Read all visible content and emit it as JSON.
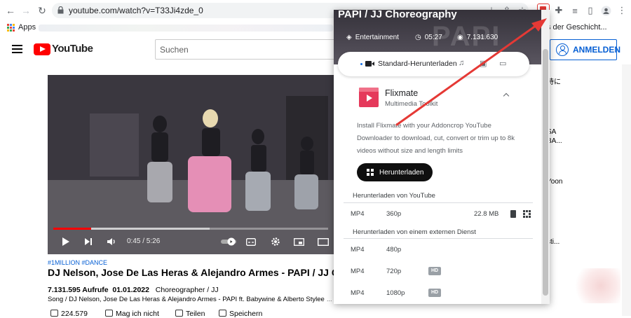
{
  "browser": {
    "url": "youtube.com/watch?v=T33Ji4zde_0",
    "bookmarks_apps": "Apps",
    "bookmark_right": "s der Geschicht..."
  },
  "youtube": {
    "logo_text": "YouTube",
    "search_placeholder": "Suchen",
    "signin_label": "ANMELDEN",
    "video": {
      "time": "0:45 / 5:26",
      "progress": 0.138,
      "buffered": 0.57,
      "tags": "#1MILLION #DANCE",
      "title": "DJ Nelson, Jose De Las Heras & Alejandro Armes - PAPI / JJ Choreography",
      "views": "7.131.595 Aufrufe",
      "date": "01.01.2022",
      "category": "Choreographer / JJ",
      "description": "Song / DJ Nelson, Jose De Las Heras & Alejandro Armes - PAPI ft. Babywine & Alberto Stylee",
      "more": "...",
      "likes": "224.579",
      "dislike": "Mag ich nicht",
      "share": "Teilen",
      "save": "Speichern"
    },
    "sidebar_fragments": [
      "時に",
      "SA",
      "BA...",
      "Yoon",
      "sti..."
    ]
  },
  "popup": {
    "hero_title": "PAPI / JJ Choreography",
    "hero_watermark": "PAPI",
    "category": "Entertainment",
    "duration": "05:27",
    "views": "7.131.630",
    "tab_active": "Standard-Herunterladen",
    "app_name": "Flixmate",
    "app_subtitle": "Multimedia Toolkit",
    "app_description": "Install Flixmate with your Addoncrop YouTube Downloader to download, cut, convert or trim up to 8k videos without size and length limits",
    "download_button": "Herunterladen",
    "section_youtube": "Herunterladen von YouTube",
    "section_external": "Herunterladen von einem externen Dienst",
    "youtube_rows": [
      {
        "format": "MP4",
        "resolution": "360p",
        "size": "22.8 MB"
      }
    ],
    "external_rows": [
      {
        "format": "MP4",
        "resolution": "480p",
        "badge": ""
      },
      {
        "format": "MP4",
        "resolution": "720p",
        "badge": "HD"
      },
      {
        "format": "MP4",
        "resolution": "1080p",
        "badge": "HD"
      }
    ]
  },
  "colors": {
    "youtube_red": "#ff0000",
    "link_blue": "#065fd4",
    "annotation_arrow": "#e53935"
  }
}
